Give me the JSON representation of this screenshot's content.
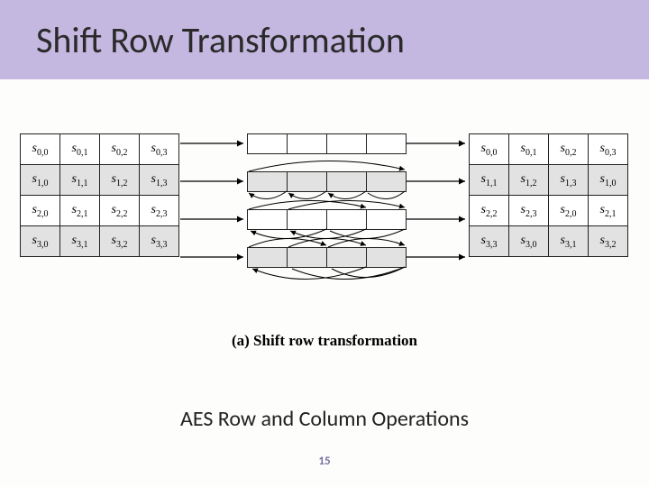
{
  "header": {
    "title": "Shift Row Transformation"
  },
  "caption_a": "(a) Shift row transformation",
  "subtitle": "AES Row and Column Operations",
  "page_number": "15",
  "left_grid": [
    [
      "s0,0",
      "s0,1",
      "s0,2",
      "s0,3"
    ],
    [
      "s1,0",
      "s1,1",
      "s1,2",
      "s1,3"
    ],
    [
      "s2,0",
      "s2,1",
      "s2,2",
      "s2,3"
    ],
    [
      "s3,0",
      "s3,1",
      "s3,2",
      "s3,3"
    ]
  ],
  "right_grid": [
    [
      "s0,0",
      "s0,1",
      "s0,2",
      "s0,3"
    ],
    [
      "s1,1",
      "s1,2",
      "s1,3",
      "s1,0"
    ],
    [
      "s2,2",
      "s2,3",
      "s2,0",
      "s2,1"
    ],
    [
      "s3,3",
      "s3,0",
      "s3,1",
      "s3,2"
    ]
  ],
  "shift_amounts": [
    0,
    1,
    2,
    3
  ]
}
